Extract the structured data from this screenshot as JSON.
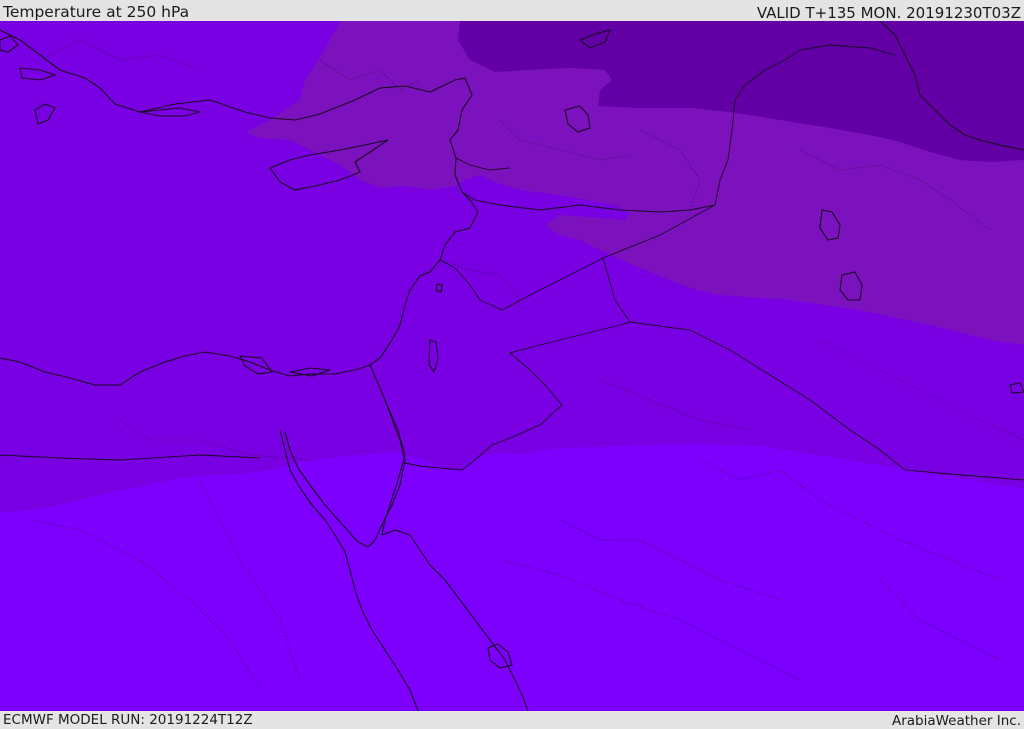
{
  "header": {
    "title": "Temperature at 250 hPa",
    "valid": "VALID T+135 MON. 20191230T03Z"
  },
  "footer": {
    "model_run": "ECMWF MODEL RUN: 20191224T12Z",
    "credit": "ArabiaWeather Inc."
  },
  "map": {
    "field": "temperature",
    "level": "250 hPa",
    "colors": {
      "darkest_band": "#6200a6",
      "dark_band": "#7b12bd",
      "mid_band": "#7a00e4",
      "warm_band": "#7d00fe",
      "coastline": "#1a0a22"
    }
  }
}
